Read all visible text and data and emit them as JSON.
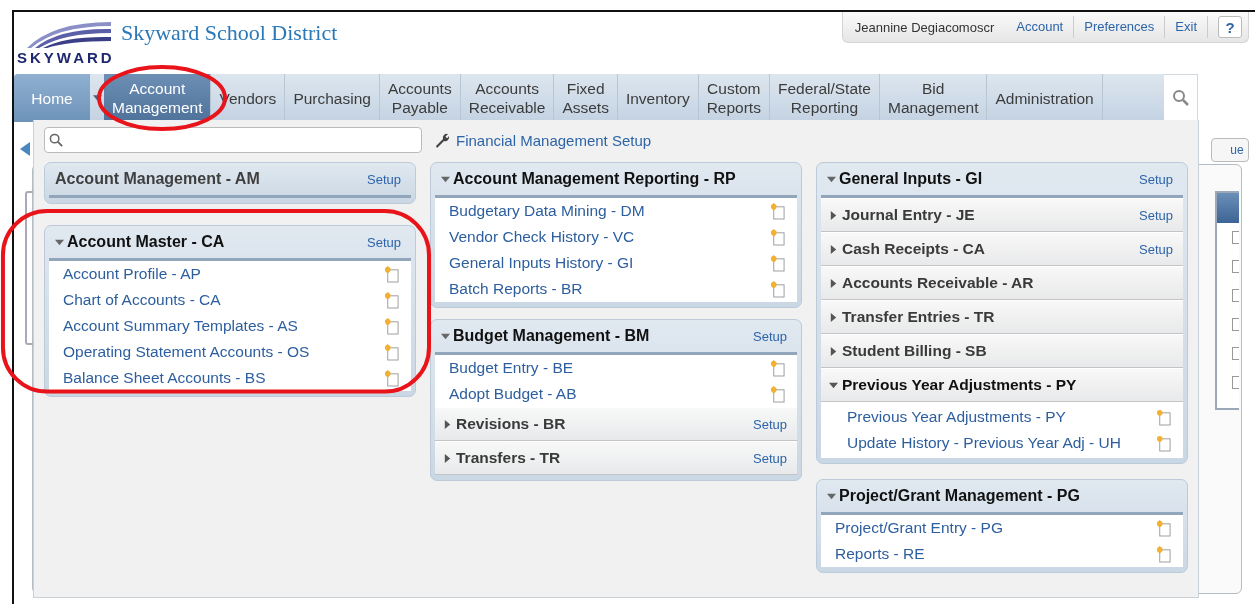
{
  "logo": {
    "text": "SKYWARD"
  },
  "site_title": "Skyward School District",
  "user_bar": {
    "user": "Jeannine Degiacomoscr",
    "links": [
      "Account",
      "Preferences",
      "Exit"
    ],
    "help": "?"
  },
  "tabs": [
    {
      "label": "Home",
      "kind": "home",
      "selected": false,
      "circled": false
    },
    {
      "label": "Account Management",
      "kind": "module",
      "selected": true,
      "circled": true
    },
    {
      "label": "Vendors",
      "kind": "module",
      "selected": false,
      "circled": false
    },
    {
      "label": "Purchasing",
      "kind": "module",
      "selected": false,
      "circled": false
    },
    {
      "label": "Accounts Payable",
      "kind": "module",
      "selected": false,
      "circled": false
    },
    {
      "label": "Accounts Receivable",
      "kind": "module",
      "selected": false,
      "circled": false
    },
    {
      "label": "Fixed Assets",
      "kind": "module",
      "selected": false,
      "circled": false
    },
    {
      "label": "Inventory",
      "kind": "module",
      "selected": false,
      "circled": false
    },
    {
      "label": "Custom Reports",
      "kind": "module",
      "selected": false,
      "circled": false
    },
    {
      "label": "Federal/State Reporting",
      "kind": "module",
      "selected": false,
      "circled": false
    },
    {
      "label": "Bid Management",
      "kind": "module",
      "selected": false,
      "circled": false
    },
    {
      "label": "Administration",
      "kind": "module",
      "selected": false,
      "circled": false
    }
  ],
  "background_button": "ue",
  "menu": {
    "setup_link": "Financial Management Setup",
    "columns": [
      [
        {
          "title": "Account Management - AM",
          "toggle": false,
          "setup": "Setup",
          "circled": false
        },
        {
          "title": "Account Master - CA",
          "toggle": true,
          "expanded": true,
          "setup": "Setup",
          "circled": true,
          "items": [
            {
              "kind": "link",
              "label": "Account Profile - AP"
            },
            {
              "kind": "link",
              "label": "Chart of Accounts - CA"
            },
            {
              "kind": "link",
              "label": "Account Summary Templates - AS"
            },
            {
              "kind": "link",
              "label": "Operating Statement Accounts - OS"
            },
            {
              "kind": "link",
              "label": "Balance Sheet Accounts - BS"
            }
          ]
        }
      ],
      [
        {
          "title": "Account Management Reporting - RP",
          "toggle": true,
          "expanded": true,
          "circled": false,
          "items": [
            {
              "kind": "link",
              "label": "Budgetary Data Mining - DM"
            },
            {
              "kind": "link",
              "label": "Vendor Check History - VC"
            },
            {
              "kind": "link",
              "label": "General Inputs History - GI"
            },
            {
              "kind": "link",
              "label": "Batch Reports - BR"
            }
          ]
        },
        {
          "title": "Budget Management - BM",
          "toggle": true,
          "expanded": true,
          "setup": "Setup",
          "circled": false,
          "items": [
            {
              "kind": "link",
              "label": "Budget Entry - BE"
            },
            {
              "kind": "link",
              "label": "Adopt Budget - AB"
            },
            {
              "kind": "group",
              "label": "Revisions - BR",
              "expanded": false,
              "setup": "Setup"
            },
            {
              "kind": "group",
              "label": "Transfers - TR",
              "expanded": false,
              "setup": "Setup"
            }
          ]
        }
      ],
      [
        {
          "title": "General Inputs - GI",
          "toggle": true,
          "expanded": true,
          "setup": "Setup",
          "circled": false,
          "items": [
            {
              "kind": "group",
              "label": "Journal Entry - JE",
              "expanded": false,
              "setup": "Setup"
            },
            {
              "kind": "group",
              "label": "Cash Receipts - CA",
              "expanded": false,
              "setup": "Setup"
            },
            {
              "kind": "group",
              "label": "Accounts Receivable - AR",
              "expanded": false
            },
            {
              "kind": "group",
              "label": "Transfer Entries - TR",
              "expanded": false
            },
            {
              "kind": "group",
              "label": "Student Billing - SB",
              "expanded": false
            },
            {
              "kind": "group",
              "label": "Previous Year Adjustments - PY",
              "expanded": true,
              "children": [
                {
                  "kind": "link",
                  "label": "Previous Year Adjustments - PY"
                },
                {
                  "kind": "link",
                  "label": "Update History - Previous Year Adj - UH"
                }
              ]
            }
          ]
        },
        {
          "title": "Project/Grant Management - PG",
          "toggle": true,
          "expanded": true,
          "circled": false,
          "items": [
            {
              "kind": "link",
              "label": "Project/Grant Entry - PG"
            },
            {
              "kind": "link",
              "label": "Reports - RE"
            }
          ]
        }
      ]
    ]
  }
}
